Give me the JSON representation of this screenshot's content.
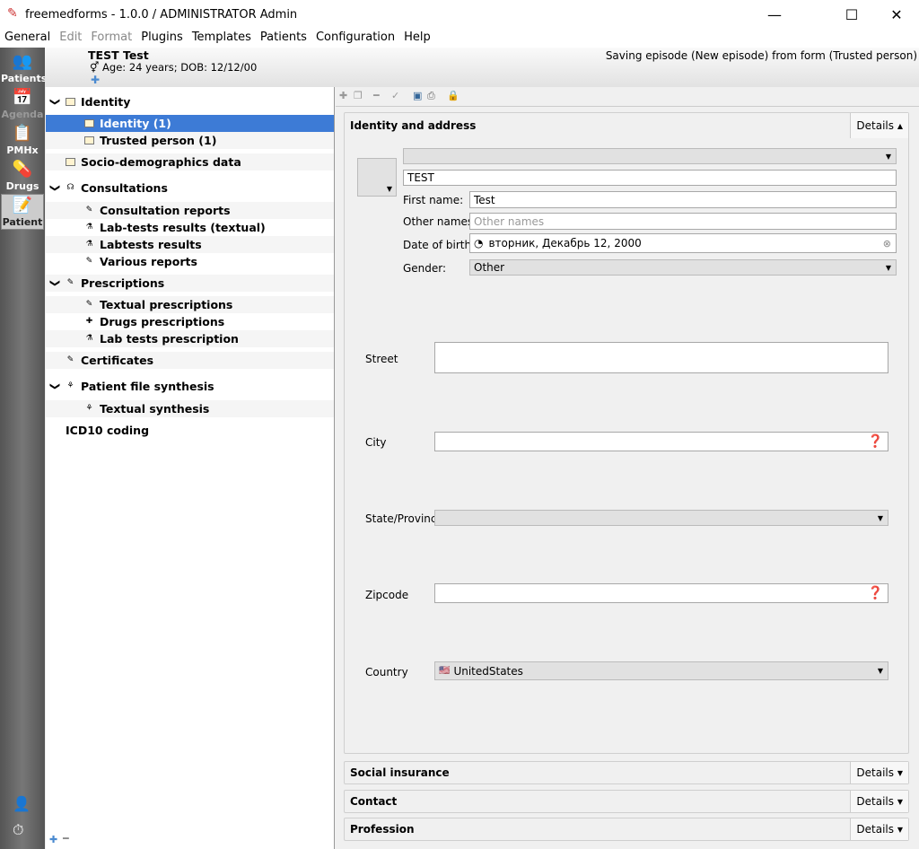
{
  "window": {
    "title": "freemedforms - 1.0.0 /  ADMINISTRATOR Admin",
    "minimize": "—",
    "maximize": "☐",
    "close": "✕"
  },
  "menu": [
    {
      "label": "General",
      "enabled": true
    },
    {
      "label": "Edit",
      "enabled": false
    },
    {
      "label": "Format",
      "enabled": false
    },
    {
      "label": "Plugins",
      "enabled": true
    },
    {
      "label": "Templates",
      "enabled": true
    },
    {
      "label": "Patients",
      "enabled": true
    },
    {
      "label": "Configuration",
      "enabled": true
    },
    {
      "label": "Help",
      "enabled": true
    }
  ],
  "modes": [
    {
      "label": "Patients",
      "icon": "patients-icon"
    },
    {
      "label": "Agenda",
      "icon": "calendar-icon",
      "disabled": true
    },
    {
      "label": "PMHx",
      "icon": "pmhx-icon"
    },
    {
      "label": "Drugs",
      "icon": "drugs-icon"
    },
    {
      "label": "Patient",
      "icon": "patient-file-icon",
      "selected": true
    }
  ],
  "patient": {
    "name": "TEST Test",
    "info": "Age: 24 years; DOB: 12/12/00",
    "gender_symbol": "⚥"
  },
  "status": "Saving episode (New episode) from form (Trusted person)",
  "tree": [
    {
      "label": "Identity",
      "level": 0,
      "expanded": true
    },
    {
      "label": "Identity (1)",
      "level": 1,
      "selected": true
    },
    {
      "label": "Trusted person (1)",
      "level": 1
    },
    {
      "label": "Socio-demographics data",
      "level": 0
    },
    {
      "label": "Consultations",
      "level": 0,
      "expanded": true
    },
    {
      "label": "Consultation reports",
      "level": 1
    },
    {
      "label": "Lab-tests results (textual)",
      "level": 1
    },
    {
      "label": "Labtests results",
      "level": 1
    },
    {
      "label": "Various reports",
      "level": 1
    },
    {
      "label": "Prescriptions",
      "level": 0,
      "expanded": true
    },
    {
      "label": "Textual prescriptions",
      "level": 1
    },
    {
      "label": "Drugs prescriptions",
      "level": 1
    },
    {
      "label": "Lab tests prescription",
      "level": 1
    },
    {
      "label": "Certificates",
      "level": 0
    },
    {
      "label": "Patient file synthesis",
      "level": 0,
      "expanded": true
    },
    {
      "label": "Textual synthesis",
      "level": 1
    },
    {
      "label": "ICD10 coding",
      "level": 0
    }
  ],
  "form": {
    "title": "Identity and address",
    "details": "Details",
    "title_combo": "",
    "last_name": "TEST",
    "first_name_label": "First name:",
    "first_name": "Test",
    "other_names_label": "Other names:",
    "other_names_placeholder": "Other names",
    "dob_label": "Date of birth:",
    "dob": "вторник, Декабрь 12, 2000",
    "gender_label": "Gender:",
    "gender": "Other",
    "street_label": "Street",
    "street": "",
    "city_label": "City",
    "city": "",
    "state_label": "State/Province",
    "state": "",
    "zip_label": "Zipcode",
    "zip": "",
    "country_label": "Country",
    "country": "UnitedStates"
  },
  "sections": [
    {
      "title": "Social insurance",
      "details": "Details"
    },
    {
      "title": "Contact",
      "details": "Details"
    },
    {
      "title": "Profession",
      "details": "Details"
    }
  ]
}
